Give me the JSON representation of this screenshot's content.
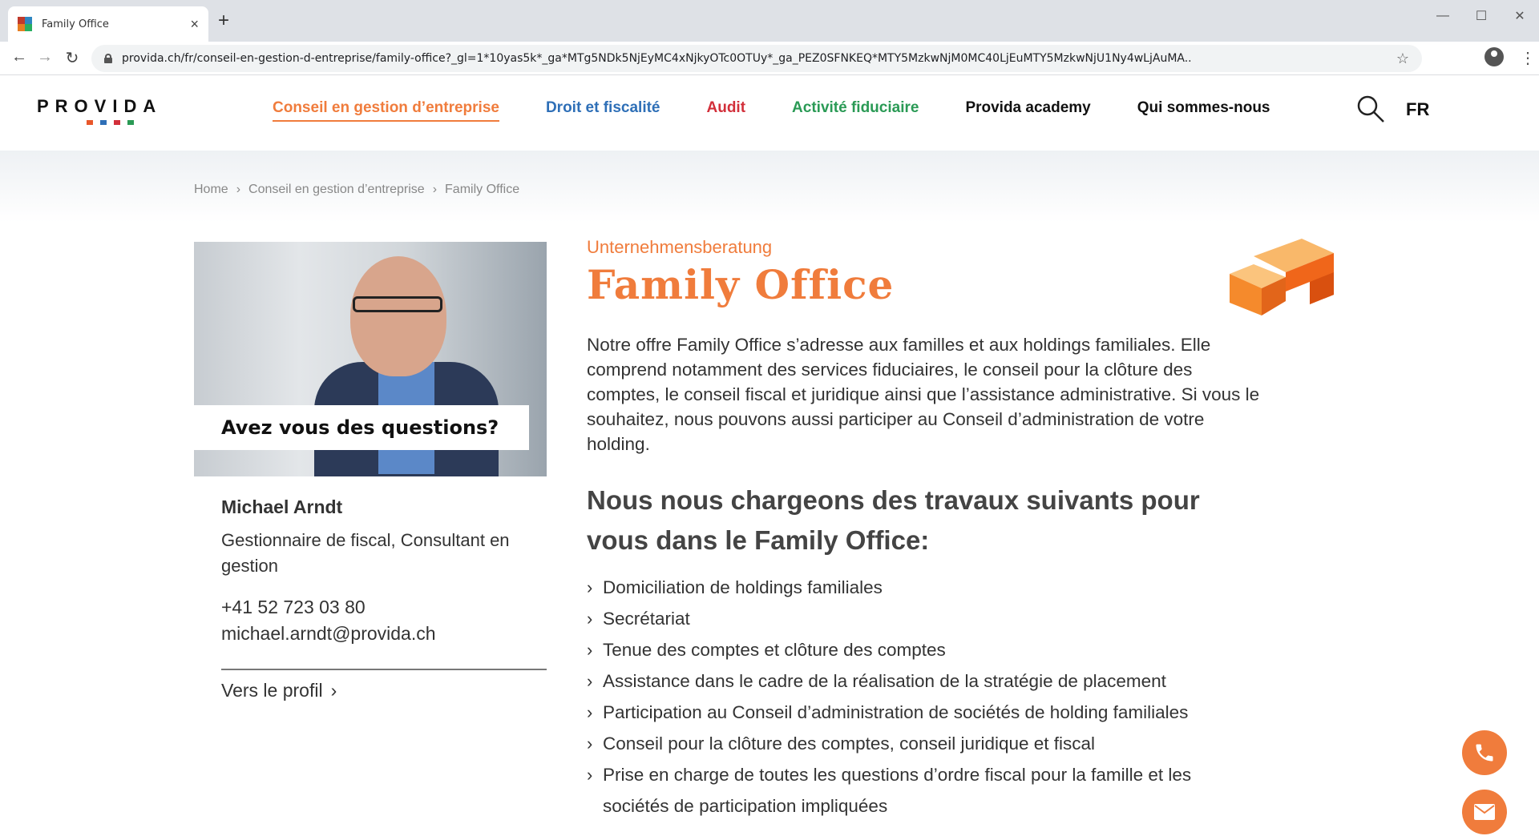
{
  "browser": {
    "tab_title": "Family Office",
    "close_glyph": "×",
    "newtab_glyph": "+",
    "url": "provida.ch/fr/conseil-en-gestion-d-entreprise/family-office?_gl=1*10yas5k*_ga*MTg5NDk5NjEyMC4xNjkyOTc0OTUy*_ga_PEZ0SFNKEQ*MTY5MzkwNjM0MC40LjEuMTY5MzkwNjU1Ny4wLjAuMA..",
    "icons": [
      "back-icon",
      "forward-icon",
      "reload-icon",
      "lock-icon",
      "star-icon",
      "profile-icon",
      "menu-icon"
    ]
  },
  "header": {
    "logo": "PROVIDA",
    "logo_dot_colors": [
      "#e8572a",
      "#2e6fb7",
      "#d22f3a",
      "#2a9a55"
    ],
    "nav": [
      {
        "label": "Conseil en gestion d’entreprise",
        "color": "#f07c3c",
        "active": true
      },
      {
        "label": "Droit et fiscalité",
        "color": "#2e6fb7",
        "active": false
      },
      {
        "label": "Audit",
        "color": "#d22f3a",
        "active": false
      },
      {
        "label": "Activité fiduciaire",
        "color": "#2a9a55",
        "active": false
      },
      {
        "label": "Provida academy",
        "color": "#111111",
        "active": false
      },
      {
        "label": "Qui sommes-nous",
        "color": "#111111",
        "active": false
      }
    ],
    "lang": "FR"
  },
  "breadcrumb": [
    "Home",
    "Conseil en gestion d’entreprise",
    "Family Office"
  ],
  "contact": {
    "question": "Avez vous des questions?",
    "name": "Michael Arndt",
    "role": "Gestionnaire de fiscal, Consultant en gestion",
    "phone": "+41 52 723 03 80",
    "email": "michael.arndt@provida.ch",
    "profile_link": "Vers le profil"
  },
  "main": {
    "subtitle": "Unternehmensberatung",
    "title": "Family Office",
    "intro": "Notre offre Family Office s’adresse aux familles et aux holdings familiales. Elle comprend notamment des services fiduciaires, le conseil pour la clôture des comptes, le conseil fiscal et juridique ainsi que l’assistance administrative. Si vous le souhaitez, nous pouvons aussi participer au Conseil d’administration de votre holding.",
    "heading": "Nous nous chargeons des travaux suivants pour vous dans le Family Office:",
    "services": [
      "Domiciliation de holdings familiales",
      "Secrétariat",
      "Tenue des comptes et clôture des comptes",
      "Assistance dans le cadre de la réalisation de la stratégie de placement",
      "Participation au Conseil d’administration de sociétés de holding familiales",
      "Conseil pour la clôture des comptes, conseil juridique et fiscal",
      "Prise en charge de toutes les questions d’ordre fiscal pour la famille et les sociétés de participation impliquées"
    ]
  },
  "accent_color": "#f07c3c"
}
